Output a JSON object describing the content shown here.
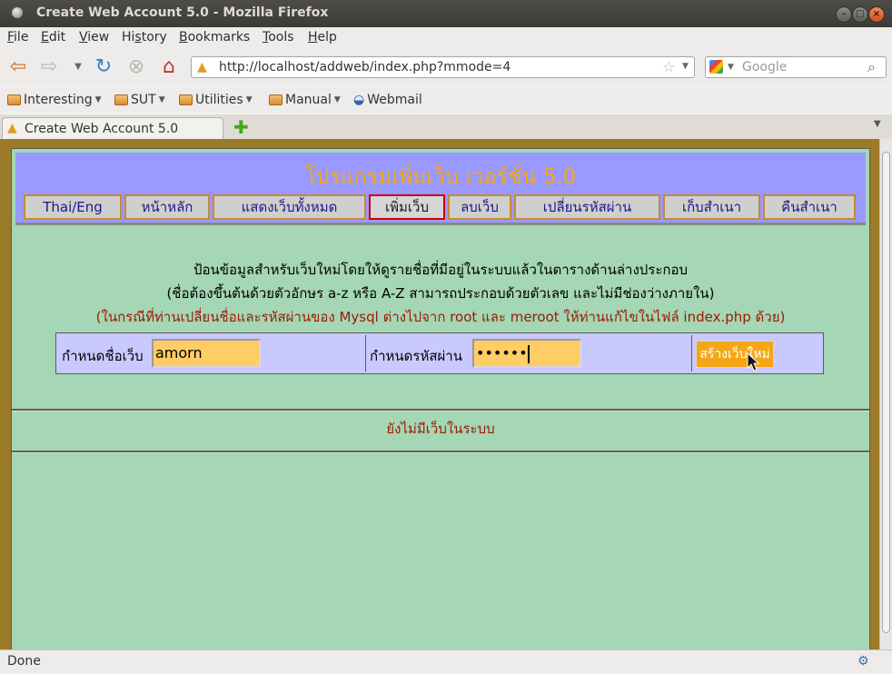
{
  "window": {
    "title": "Create Web Account 5.0 - Mozilla Firefox"
  },
  "menu": {
    "items": [
      "File",
      "Edit",
      "View",
      "History",
      "Bookmarks",
      "Tools",
      "Help"
    ],
    "accel": [
      "F",
      "E",
      "V",
      "s",
      "B",
      "T",
      "H"
    ]
  },
  "nav": {
    "url": "http://localhost/addweb/index.php?mmode=4",
    "search_placeholder": "Google"
  },
  "bookmarks": [
    {
      "label": "Interesting",
      "type": "folder"
    },
    {
      "label": "SUT",
      "type": "folder"
    },
    {
      "label": "Utilities",
      "type": "folder"
    },
    {
      "label": "Manual",
      "type": "folder"
    },
    {
      "label": "Webmail",
      "type": "link"
    }
  ],
  "tab": {
    "label": "Create Web Account 5.0"
  },
  "page": {
    "title": "โปรแกรมเพิ่มเว็บ เวอร์ชั่น 5.0",
    "nav": [
      {
        "label": "Thai/Eng",
        "active": false
      },
      {
        "label": "หน้าหลัก",
        "active": false
      },
      {
        "label": "แสดงเว็บทั้งหมด",
        "active": false
      },
      {
        "label": "เพิ่มเว็บ",
        "active": true
      },
      {
        "label": "ลบเว็บ",
        "active": false
      },
      {
        "label": "เปลี่ยนรหัสผ่าน",
        "active": false
      },
      {
        "label": "เก็บสำเนา",
        "active": false
      },
      {
        "label": "คืนสำเนา",
        "active": false
      }
    ],
    "intro_line1": "ป้อนข้อมูลสำหรับเว็บใหม่โดยให้ดูรายชื่อที่มีอยู่ในระบบแล้วในตารางด้านล่างประกอบ",
    "intro_line2": "(ชื่อต้องขึ้นต้นด้วยตัวอักษร a-z หรือ A-Z สามารถประกอบด้วยตัวเลข และไม่มีช่องว่างภายใน)",
    "intro_line3": "(ในกรณีที่ท่านเปลี่ยนชื่อและรหัสผ่านของ Mysql ต่างไปจาก root และ meroot ให้ท่านแก้ไขในไฟล์ index.php ด้วย)",
    "form": {
      "name_label": "กำหนดชื่อเว็บ",
      "name_value": "amorn",
      "password_label": "กำหนดรหัสผ่าน",
      "password_value": "••••••",
      "submit_label": "สร้างเว็บใหม่"
    },
    "no_site_text": "ยังไม่มีเว็บในระบบ"
  },
  "status": {
    "text": "Done"
  },
  "colors": {
    "page_bg": "#9b7a28",
    "panel_bg": "#a5d6b5",
    "header_bg": "#9999ff",
    "title_color": "#f4a716",
    "input_bg": "#ffcc66",
    "warn_color": "#9b1a00"
  }
}
